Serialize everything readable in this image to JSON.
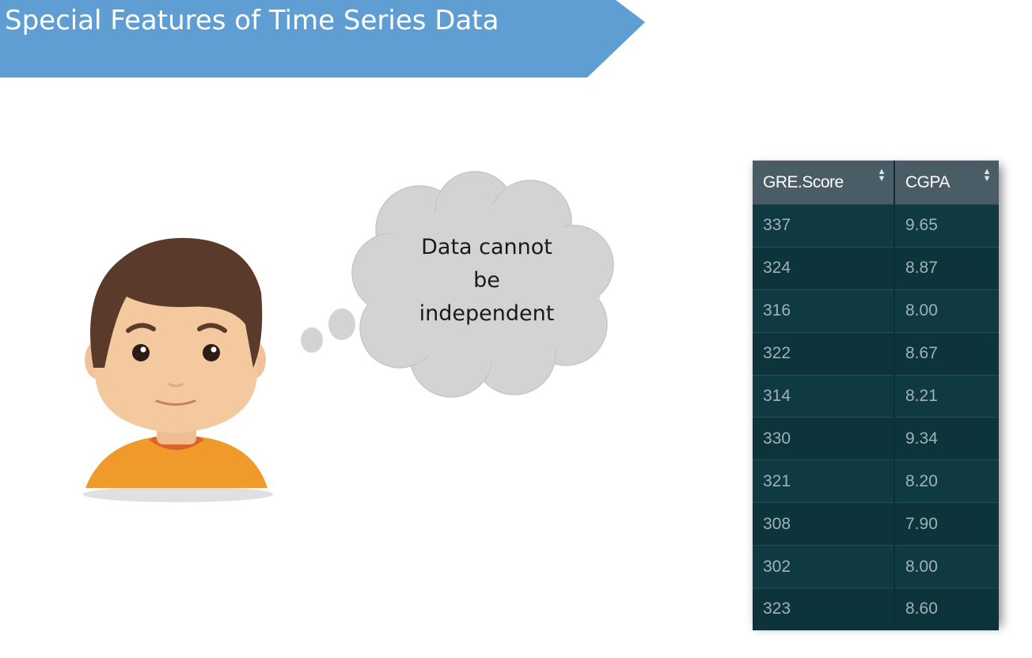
{
  "slide": {
    "title": "Special Features of Time Series Data"
  },
  "thought_bubble": {
    "lines": [
      "Data cannot",
      "be",
      "independent"
    ]
  },
  "data_table": {
    "columns": [
      "GRE.Score",
      "CGPA"
    ],
    "rows": [
      [
        "337",
        "9.65"
      ],
      [
        "324",
        "8.87"
      ],
      [
        "316",
        "8.00"
      ],
      [
        "322",
        "8.67"
      ],
      [
        "314",
        "8.21"
      ],
      [
        "330",
        "9.34"
      ],
      [
        "321",
        "8.20"
      ],
      [
        "308",
        "7.90"
      ],
      [
        "302",
        "8.00"
      ],
      [
        "323",
        "8.60"
      ]
    ]
  },
  "colors": {
    "banner": "#5f9ed3",
    "table_bg": "#0b2f36",
    "header_bg": "#4a5d66",
    "cloud": "#d3d3d3",
    "shirt": "#ef9a2a",
    "hair": "#5a3a2b",
    "skin": "#f5c9a0"
  },
  "icons": [
    "sort-icon",
    "person-avatar",
    "thought-cloud"
  ]
}
